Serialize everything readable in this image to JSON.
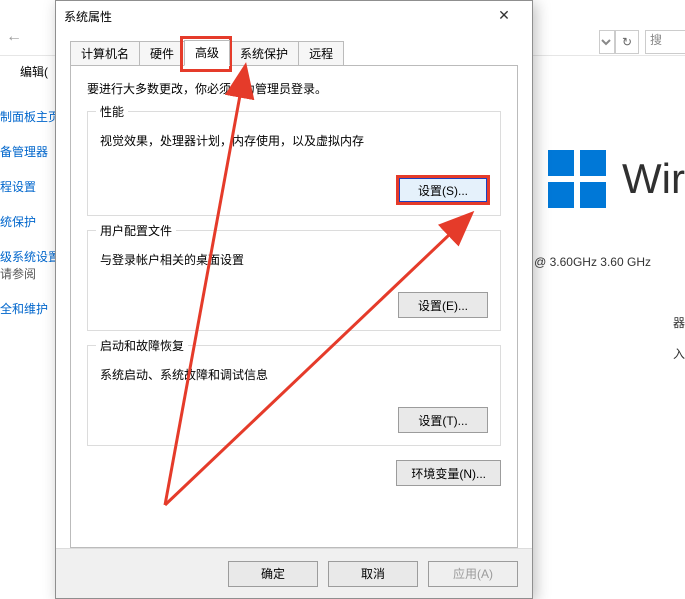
{
  "background": {
    "edit_menu": "编辑(",
    "search_placeholder": "搜",
    "sidebar_links": [
      "制面板主页",
      "备管理器",
      "程设置",
      "统保护",
      "级系统设置"
    ],
    "see_also_header": "请参阅",
    "see_also_link": "全和维护",
    "windows_text": "Wir",
    "cpu_text": "@ 3.60GHz   3.60 GHz",
    "right_cropped": [
      "器",
      "入"
    ]
  },
  "dialog": {
    "title": "系统属性",
    "tabs": [
      "计算机名",
      "硬件",
      "高级",
      "系统保护",
      "远程"
    ],
    "active_tab_index": 2,
    "intro": "要进行大多数更改，你必须作为管理员登录。",
    "groups": {
      "performance": {
        "legend": "性能",
        "desc": "视觉效果，处理器计划，内存使用，以及虚拟内存",
        "button": "设置(S)..."
      },
      "profiles": {
        "legend": "用户配置文件",
        "desc": "与登录帐户相关的桌面设置",
        "button": "设置(E)..."
      },
      "startup": {
        "legend": "启动和故障恢复",
        "desc": "系统启动、系统故障和调试信息",
        "button": "设置(T)..."
      }
    },
    "env_button": "环境变量(N)...",
    "actions": {
      "ok": "确定",
      "cancel": "取消",
      "apply": "应用(A)"
    }
  },
  "annotation": {
    "color": "#e53b2a"
  }
}
